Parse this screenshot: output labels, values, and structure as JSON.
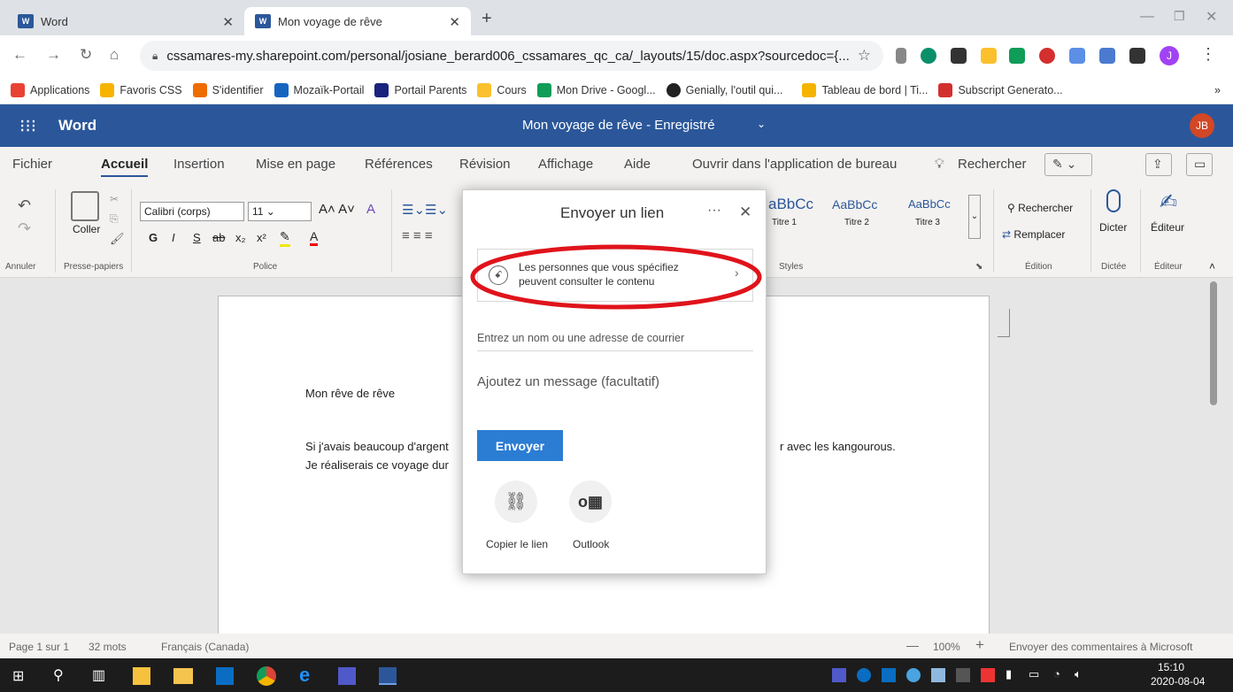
{
  "browser": {
    "tabs": [
      {
        "label": "Word"
      },
      {
        "label": "Mon voyage de rêve"
      }
    ],
    "new_tab": "+",
    "url": "cssamares-my.sharepoint.com/personal/josiane_berard006_cssamares_qc_ca/_layouts/15/doc.aspx?sourcedoc={...",
    "profile_initial": "J",
    "bookmarks": [
      {
        "label": "Applications",
        "color": "#e94235"
      },
      {
        "label": "Favoris CSS",
        "color": "#f6b400"
      },
      {
        "label": "S'identifier",
        "color": "#ef6c00"
      },
      {
        "label": "Mozaïk-Portail",
        "color": "#1565c0"
      },
      {
        "label": "Portail Parents",
        "color": "#1a237e"
      },
      {
        "label": "Cours",
        "color": "#fbc02d"
      },
      {
        "label": "Mon Drive - Googl...",
        "color": "#0f9d58"
      },
      {
        "label": "Genially, l'outil qui...",
        "color": "#222222"
      },
      {
        "label": "Tableau de bord | Ti...",
        "color": "#f4b400"
      },
      {
        "label": "Subscript Generato...",
        "color": "#d32f2f"
      }
    ],
    "bookmarks_more": "»"
  },
  "word": {
    "app_name": "Word",
    "doc_title": "Mon voyage de rêve - Enregistré",
    "avatar": "JB",
    "accent": "#2b579a",
    "ribbon_tabs": [
      "Fichier",
      "Accueil",
      "Insertion",
      "Mise en page",
      "Références",
      "Révision",
      "Affichage",
      "Aide",
      "Ouvrir dans l'application de bureau"
    ],
    "search": "Rechercher",
    "font_name": "Calibri (corps)",
    "font_size": "11",
    "groups": {
      "undo": "Annuler",
      "clipboard": "Presse-papiers",
      "font": "Police",
      "styles": "Styles",
      "editing": "Édition",
      "dictation": "Dictée",
      "editor": "Éditeur"
    },
    "paste_label": "Coller",
    "font_buttons": [
      "G",
      "I",
      "S",
      "ab",
      "x₂",
      "x²"
    ],
    "styles": [
      {
        "sample": "aBbCc",
        "name": "Titre 1"
      },
      {
        "sample": "AaBbCc",
        "name": "Titre 2"
      },
      {
        "sample": "AaBbCc",
        "name": "Titre 3"
      }
    ],
    "find_label": "Rechercher",
    "replace_label": "Remplacer",
    "dictate_label": "Dicter",
    "editor_label": "Éditeur"
  },
  "document": {
    "heading": "Mon rêve de rêve",
    "line1_left": "Si j'avais beaucoup d'argent",
    "line1_right": "r avec les kangourous.",
    "line2_left": "Je réaliserais ce voyage dur"
  },
  "status": {
    "page": "Page 1 sur 1",
    "words": "32 mots",
    "language": "Français (Canada)",
    "zoom": "100%",
    "feedback": "Envoyer des commentaires à Microsoft",
    "zoom_minus": "—",
    "zoom_plus": "+"
  },
  "dialog": {
    "title": "Envoyer un lien",
    "more": "···",
    "close": "✕",
    "permission_line1": "Les personnes que vous spécifiez",
    "permission_line2": "peuvent consulter le contenu",
    "recipient_placeholder": "Entrez un nom ou une adresse de courrier",
    "message_placeholder": "Ajoutez un message (facultatif)",
    "send": "Envoyer",
    "copy_link": "Copier le lien",
    "outlook": "Outlook",
    "highlight_color": "#e0131b"
  },
  "taskbar": {
    "time": "15:10",
    "date": "2020-08-04"
  }
}
